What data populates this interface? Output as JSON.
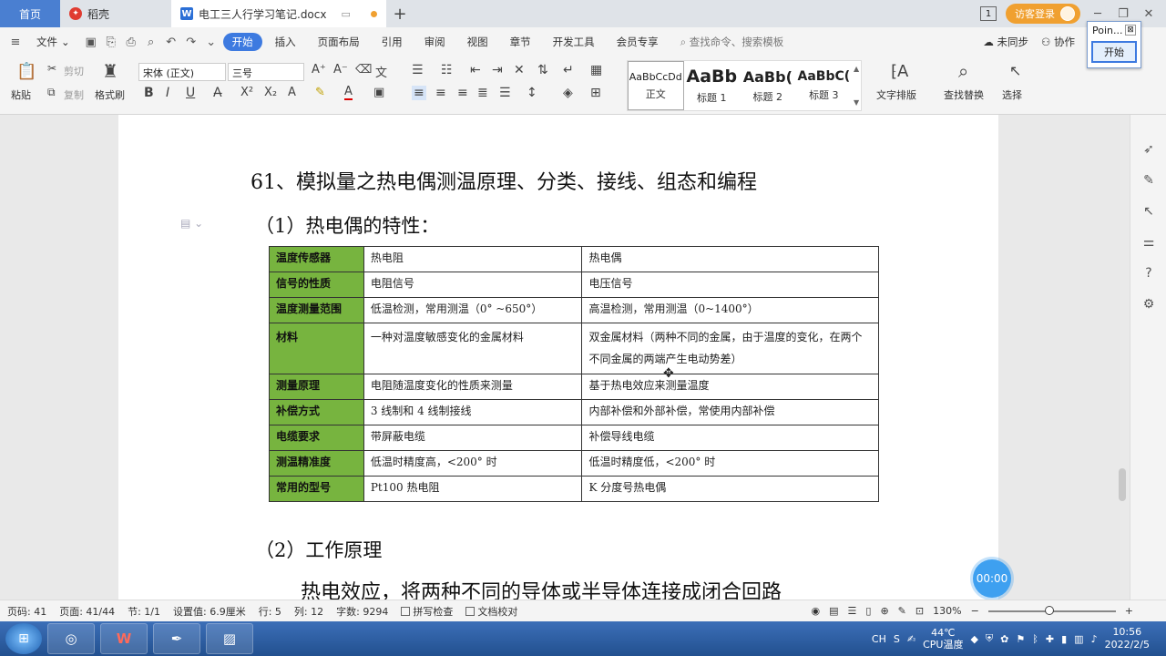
{
  "tabs": {
    "home": "首页",
    "docer": "稻壳",
    "doc": "电工三人行学习笔记.docx"
  },
  "header": {
    "badge": "1",
    "visitor_login": "访客登录"
  },
  "menu": {
    "file": "文件",
    "items": [
      "开始",
      "插入",
      "页面布局",
      "引用",
      "审阅",
      "视图",
      "章节",
      "开发工具",
      "会员专享"
    ],
    "search": "查找命令、搜索模板",
    "not_synced": "未同步",
    "collab": "协作"
  },
  "ribbon": {
    "paste": "粘贴",
    "cut": "剪切",
    "copy": "复制",
    "format_painter": "格式刷",
    "font": "宋体 (正文)",
    "size": "三号",
    "styles": [
      {
        "preview": "AaBbCcDd",
        "label": "正文"
      },
      {
        "preview": "AaBb",
        "label": "标题 1"
      },
      {
        "preview": "AaBb(",
        "label": "标题 2"
      },
      {
        "preview": "AaBbC(",
        "label": "标题 3"
      }
    ],
    "text_layout": "文字排版",
    "find_replace": "查找替换",
    "select": "选择"
  },
  "point_popup": {
    "title": "Poin...",
    "close": "⊠",
    "start": "开始"
  },
  "document": {
    "heading": "61、模拟量之热电偶测温原理、分类、接线、组态和编程",
    "sub1": "（1）热电偶的特性：",
    "sub2": "（2）工作原理",
    "body": "热电效应，将两种不同的导体或半导体连接成闭合回路",
    "table": [
      {
        "k": "温度传感器",
        "a": "热电阻",
        "b": "热电偶"
      },
      {
        "k": "信号的性质",
        "a": "电阻信号",
        "b": "电压信号"
      },
      {
        "k": "温度测量范围",
        "a": "低温检测，常用测温（0° ~650°）",
        "b": "高温检测，常用测温（0~1400°）"
      },
      {
        "k": "材料",
        "a": "一种对温度敏感变化的金属材料",
        "b": "双金属材料（两种不同的金属，由于温度的变化，在两个不同金属的两端产生电动势差）"
      },
      {
        "k": "测量原理",
        "a": "电阻随温度变化的性质来测量",
        "b": "基于热电效应来测量温度"
      },
      {
        "k": "补偿方式",
        "a": "3 线制和 4 线制接线",
        "b": "内部补偿和外部补偿，常使用内部补偿"
      },
      {
        "k": "电缆要求",
        "a": "带屏蔽电缆",
        "b": "补偿导线电缆"
      },
      {
        "k": "测温精准度",
        "a": "低温时精度高，<200° 时",
        "b": "低温时精度低，<200° 时"
      },
      {
        "k": "常用的型号",
        "a": "Pt100 热电阻",
        "b": "K 分度号热电偶"
      }
    ],
    "timer": "00:00"
  },
  "status": {
    "page_code": "页码: 41",
    "pages": "页面: 41/44",
    "section": "节: 1/1",
    "setting": "设置值: 6.9厘米",
    "row": "行: 5",
    "col": "列: 12",
    "words": "字数: 9294",
    "spell": "拼写检查",
    "proof": "文档校对",
    "zoom": "130%"
  },
  "taskbar": {
    "ime": "CH",
    "temp": "44℃",
    "cpu": "CPU温度",
    "time": "10:56",
    "date": "2022/2/5"
  }
}
